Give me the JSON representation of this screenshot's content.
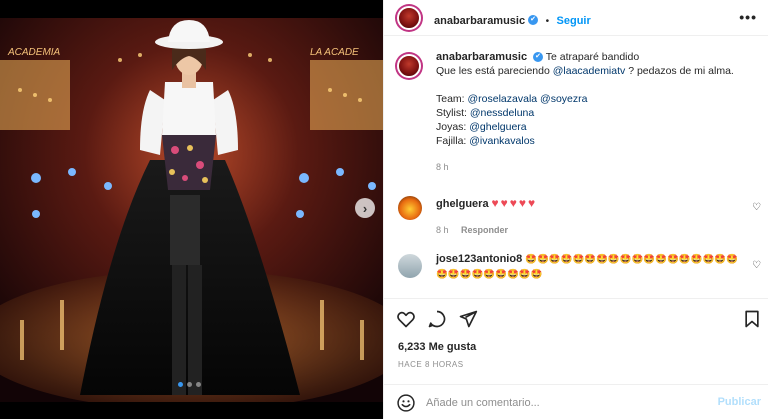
{
  "post": {
    "username": "anabarbaramusic",
    "verified_mark": "✔",
    "follow_sep": "•",
    "follow_label": "Seguir",
    "more_label": "•••",
    "caption_line1": "Te atraparé bandido",
    "caption_line2_pre": "Que les está pareciendo ",
    "caption_line2_mention": "@laacademiatv",
    "caption_line2_post": " ? pedazos de mi alma.",
    "team_label": "Team: ",
    "team_mention1": "@roselazavala",
    "team_mention2": "@soyezra",
    "stylist_label": "Stylist: ",
    "stylist_mention": "@nessdeluna",
    "joyas_label": "Joyas: ",
    "joyas_mention": "@ghelguera",
    "fajilla_label": "Fajilla: ",
    "fajilla_mention": "@ivankavalos",
    "caption_time": "8 h"
  },
  "comments": [
    {
      "username": "ghelguera",
      "text": "♥♥♥♥♥",
      "time": "8 h",
      "reply_label": "Responder"
    },
    {
      "username": "jose123antonio8",
      "text": "🤩🤩🤩🤩🤩🤩🤩🤩🤩🤩🤩🤩🤩🤩🤩🤩🤩🤩🤩🤩🤩🤩🤩🤩🤩🤩🤩"
    }
  ],
  "actions": {
    "likes": "6,233 Me gusta",
    "ago": "HACE 8 HORAS"
  },
  "add_comment": {
    "placeholder": "Añade un comentario...",
    "publish_label": "Publicar"
  },
  "icons": {
    "next": "chevron-right-icon",
    "more": "more-options-icon",
    "like": "heart-icon",
    "comment": "comment-icon",
    "share": "share-icon",
    "save": "bookmark-icon",
    "emoji": "emoji-icon"
  },
  "colors": {
    "link": "#00376b",
    "follow": "#0095f6",
    "verified": "#3897f0",
    "publish_disabled": "#b2dffc",
    "heart": "#ed4956"
  },
  "carousel": {
    "total": 3,
    "current": 1
  }
}
